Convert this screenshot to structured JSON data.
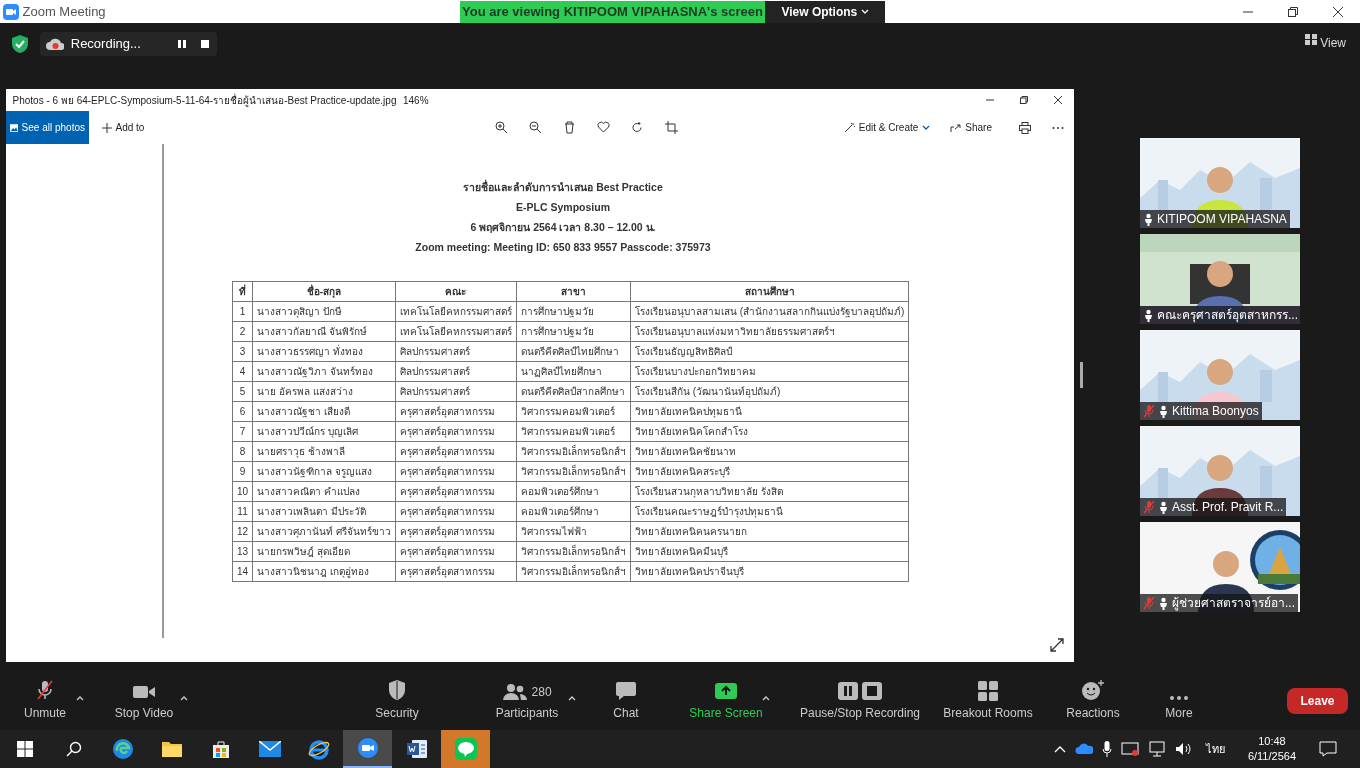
{
  "window": {
    "title": "Zoom Meeting"
  },
  "share_banner": {
    "text": "You are viewing KITIPOOM VIPAHASNA's screen",
    "view_options": "View Options"
  },
  "recording": {
    "label": "Recording..."
  },
  "view_button": "View",
  "photos_window": {
    "title": "Photos - 6 พย 64-EPLC-Symposium-5-11-64-รายชื่อผู้นำเสนอ-Best Practice-update.jpg",
    "zoom": "146%",
    "see_all": "See all photos",
    "add_to": "Add to",
    "edit_create": "Edit & Create",
    "share": "Share"
  },
  "document": {
    "heading": [
      "รายชื่อและลำดับการนำเสนอ Best Practice",
      "E-PLC Symposium",
      "6 พฤศจิกายน 2564 เวลา 8.30 – 12.00 น.",
      "Zoom meeting: Meeting ID: 650 833 9557 Passcode: 375973"
    ],
    "table": {
      "columns": [
        "ที่",
        "ชื่อ-สกุล",
        "คณะ",
        "สาขา",
        "สถานศึกษา"
      ],
      "rows": [
        [
          "1",
          "นางสาวดุสิญา  ปักษี",
          "เทคโนโลยีคหกรรมศาสตร์",
          "การศึกษาปฐมวัย",
          "โรงเรียนอนุบาลสามเสน (สำนักงานสลากกินแบ่งรัฐบาลอุปถัมภ์)"
        ],
        [
          "2",
          "นางสาวกัลยาณี จันพิรักษ์",
          "เทคโนโลยีคหกรรมศาสตร์",
          "การศึกษาปฐมวัย",
          "โรงเรียนอนุบาลแห่งมหาวิทยาลัยธรรมศาสตร์ฯ"
        ],
        [
          "3",
          "นางสาวธรรศญา ทั่งทอง",
          "ศิลปกรรมศาสตร์",
          "ดนตรีคีตศิลป์ไทยศึกษา",
          "โรงเรียนธัญญสิทธิศิลป์"
        ],
        [
          "4",
          "นางสาวณัฐวิภา  จันทร์ทอง",
          "ศิลปกรรมศาสตร์",
          "นาฏศิลป์ไทยศึกษา",
          "โรงเรียนบางปะกอกวิทยาคม"
        ],
        [
          "5",
          "นาย อัครพล แสงสว่าง",
          "ศิลปกรรมศาสตร์",
          "ดนตรีคีตศิลป์สากลศึกษา",
          "โรงเรียนสีกัน (วัฒนานันท์อุปถัมภ์)"
        ],
        [
          "6",
          "นางสาวณัฐชา เสียงดี",
          "ครุศาสตร์อุตสาหกรรม",
          "วิศวกรรมคอมพิวเตอร์",
          "วิทยาลัยเทคนิคปทุมธานี"
        ],
        [
          "7",
          "นางสาวปวีณ์กร บุญเลิศ",
          "ครุศาสตร์อุตสาหกรรม",
          "วิศวกรรมคอมพิวเตอร์",
          "วิทยาลัยเทคนิคโคกสำโรง"
        ],
        [
          "8",
          "นายศราวุธ  ช้างพาลี",
          "ครุศาสตร์อุตสาหกรรม",
          "วิศวกรรมอิเล็กทรอนิกส์ฯ",
          "วิทยาลัยเทคนิคชัยนาท"
        ],
        [
          "9",
          "นางสาวนัฐฑิกาล จรูญแสง",
          "ครุศาสตร์อุตสาหกรรม",
          "วิศวกรรมอิเล็กทรอนิกส์ฯ",
          "วิทยาลัยเทคนิคสระบุรี"
        ],
        [
          "10",
          "นางสาวคณิตา คำแปลง",
          "ครุศาสตร์อุตสาหกรรม",
          "คอมพิวเตอร์ศึกษา",
          "โรงเรียนสวนกุหลาบวิทยาลัย รังสิต"
        ],
        [
          "11",
          "นางสาวเพลินตา มีประวัติ",
          "ครุศาสตร์อุตสาหกรรม",
          "คอมพิวเตอร์ศึกษา",
          "โรงเรียนคณะราษฎร์บำรุงปทุมธานี"
        ],
        [
          "12",
          "นางสาวศุภานันท์ ศรีจันทร์ขาว",
          "ครุศาสตร์อุตสาหกรรม",
          "วิศวกรรมไฟฟ้า",
          "วิทยาลัยเทคนิคนครนายก"
        ],
        [
          "13",
          "นายกรพวิษฎ์ สุดเอียด",
          "ครุศาสตร์อุตสาหกรรม",
          "วิศวกรรมอิเล็กทรอนิกส์ฯ",
          "วิทยาลัยเทคนิคมีนบุรี"
        ],
        [
          "14",
          "นางสาวนิชนาฎ เกตุอู่ทอง",
          "ครุศาสตร์อุตสาหกรรม",
          "วิศวกรรมอิเล็กทรอนิกส์ฯ",
          "วิทยาลัยเทคนิคปราจีนบุรี"
        ]
      ]
    }
  },
  "participants": [
    {
      "name": "KITIPOOM VIPAHASNA",
      "muted": false
    },
    {
      "name": "คณะครุศาสตร์อุตสาหกรร...",
      "muted": false
    },
    {
      "name": "Kittima Boonyos",
      "muted": true
    },
    {
      "name": "Asst. Prof. Pravit R...",
      "muted": true
    },
    {
      "name": "ผู้ช่วยศาสตราจารย์อา...",
      "muted": true
    }
  ],
  "toolbar": [
    {
      "kind": "mic",
      "label": "Unmute",
      "caret": true
    },
    {
      "kind": "video",
      "label": "Stop Video",
      "caret": true
    },
    {
      "kind": "security",
      "label": "Security",
      "caret": false
    },
    {
      "kind": "participants",
      "label": "Participants",
      "count": "280",
      "caret": true
    },
    {
      "kind": "chat",
      "label": "Chat",
      "caret": false
    },
    {
      "kind": "share",
      "label": "Share Screen",
      "caret": true
    },
    {
      "kind": "record",
      "label": "Pause/Stop Recording",
      "caret": false
    },
    {
      "kind": "breakout",
      "label": "Breakout Rooms",
      "caret": false
    },
    {
      "kind": "reactions",
      "label": "Reactions",
      "caret": false
    },
    {
      "kind": "more",
      "label": "More",
      "caret": false
    }
  ],
  "leave_button": "Leave",
  "taskbar": {
    "apps": [
      {
        "kind": "edge",
        "active": false,
        "flashing": false
      },
      {
        "kind": "explorer",
        "active": false,
        "flashing": false
      },
      {
        "kind": "store",
        "active": false,
        "flashing": false
      },
      {
        "kind": "mail",
        "active": false,
        "flashing": false
      },
      {
        "kind": "ie",
        "active": false,
        "flashing": false
      },
      {
        "kind": "zoom",
        "active": true,
        "flashing": false
      },
      {
        "kind": "word",
        "active": false,
        "flashing": false
      },
      {
        "kind": "line",
        "active": false,
        "flashing": true
      }
    ],
    "language": "ไทย",
    "time": "10:48",
    "date": "6/11/2564"
  }
}
